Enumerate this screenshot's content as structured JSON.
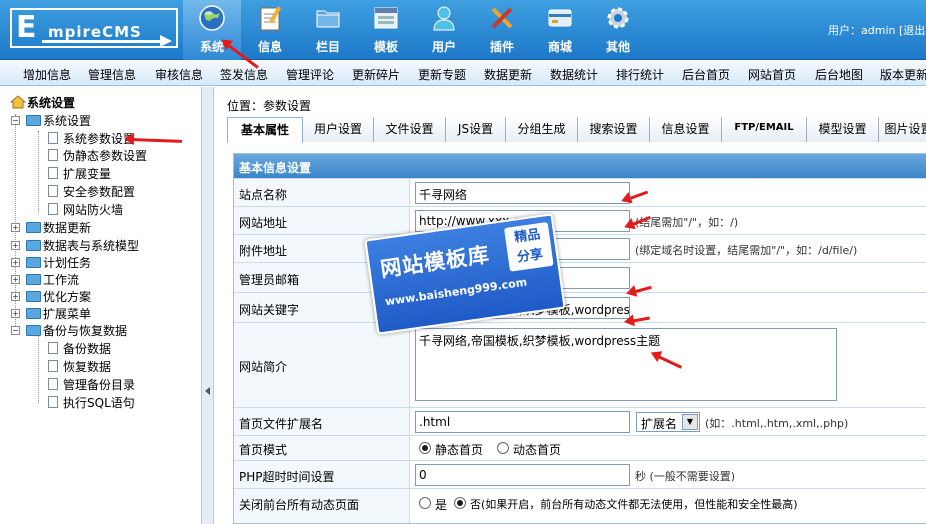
{
  "app": {
    "logo_first": "E",
    "logo_rest": "mpireCMS"
  },
  "topnav": [
    {
      "label": "系统",
      "icon": "globe-icon"
    },
    {
      "label": "信息",
      "icon": "notepad-icon"
    },
    {
      "label": "栏目",
      "icon": "folder-icon"
    },
    {
      "label": "模板",
      "icon": "window-icon"
    },
    {
      "label": "用户",
      "icon": "user-icon"
    },
    {
      "label": "插件",
      "icon": "tools-icon"
    },
    {
      "label": "商城",
      "icon": "card-icon"
    },
    {
      "label": "其他",
      "icon": "gear-icon"
    }
  ],
  "user": {
    "text": "用户：admin [退出]"
  },
  "subnav": [
    "增加信息",
    "管理信息",
    "审核信息",
    "签发信息",
    "管理评论",
    "更新碎片",
    "更新专题",
    "数据更新",
    "数据统计",
    "排行统计",
    "后台首页",
    "网站首页",
    "后台地图",
    "版本更新"
  ],
  "sidebar": {
    "root": "系统设置",
    "items": [
      {
        "label": "系统设置",
        "open": true
      },
      {
        "label": "系统参数设置"
      },
      {
        "label": "伪静态参数设置"
      },
      {
        "label": "扩展变量"
      },
      {
        "label": "安全参数配置"
      },
      {
        "label": "网站防火墙"
      },
      {
        "label": "数据更新"
      },
      {
        "label": "数据表与系统模型"
      },
      {
        "label": "计划任务"
      },
      {
        "label": "工作流"
      },
      {
        "label": "优化方案"
      },
      {
        "label": "扩展菜单"
      },
      {
        "label": "备份与恢复数据",
        "open": true
      },
      {
        "label": "备份数据"
      },
      {
        "label": "恢复数据"
      },
      {
        "label": "管理备份目录"
      },
      {
        "label": "执行SQL语句"
      }
    ]
  },
  "main": {
    "breadcrumb": "位置：参数设置",
    "tabs": [
      "基本属性",
      "用户设置",
      "文件设置",
      "JS设置",
      "分组生成",
      "搜索设置",
      "信息设置",
      "FTP/EMAIL",
      "模型设置",
      "图片设置"
    ],
    "section_title": "基本信息设置",
    "fields": {
      "site_name": {
        "label": "站点名称",
        "value": "千寻网络"
      },
      "site_url": {
        "label": "网站地址",
        "value": "http://www.xxx.com/",
        "hint": "(结尾需加\"/\"，如：/)"
      },
      "attach_url": {
        "label": "附件地址",
        "value": "",
        "hint": "(绑定域名时设置，结尾需加\"/\"，如：/d/file/)"
      },
      "admin_email": {
        "label": "管理员邮箱",
        "value": "admin@xxx.net"
      },
      "keywords": {
        "label": "网站关键字",
        "value": "千寻网络,帝国模板,织梦模板,wordpress主题"
      },
      "intro": {
        "label": "网站简介",
        "value": "千寻网络,帝国模板,织梦模板,wordpress主题"
      },
      "index_ext": {
        "label": "首页文件扩展名",
        "value": ".html",
        "select": "扩展名",
        "hint": "(如：.html,.htm,.xml,.php)"
      },
      "index_mode": {
        "label": "首页模式",
        "opt1": "静态首页",
        "opt2": "动态首页"
      },
      "php_timeout": {
        "label": "PHP超时时间设置",
        "value": "0",
        "hint": "秒 (一般不需要设置)"
      },
      "close_dynamic": {
        "label": "关闭前台所有动态页面",
        "opt1": "是",
        "opt2": "否(如果开启，前台所有动态文件都无法使用，但性能和安全性最高)"
      }
    }
  },
  "watermark": {
    "title": "网站模板库",
    "url": "www.baisheng999.com",
    "badge1": "精品",
    "badge2": "分享"
  },
  "colors": {
    "topbar": "#1d79c9",
    "accent_red": "#e31b1b",
    "header_blue": "#3a86c9"
  }
}
